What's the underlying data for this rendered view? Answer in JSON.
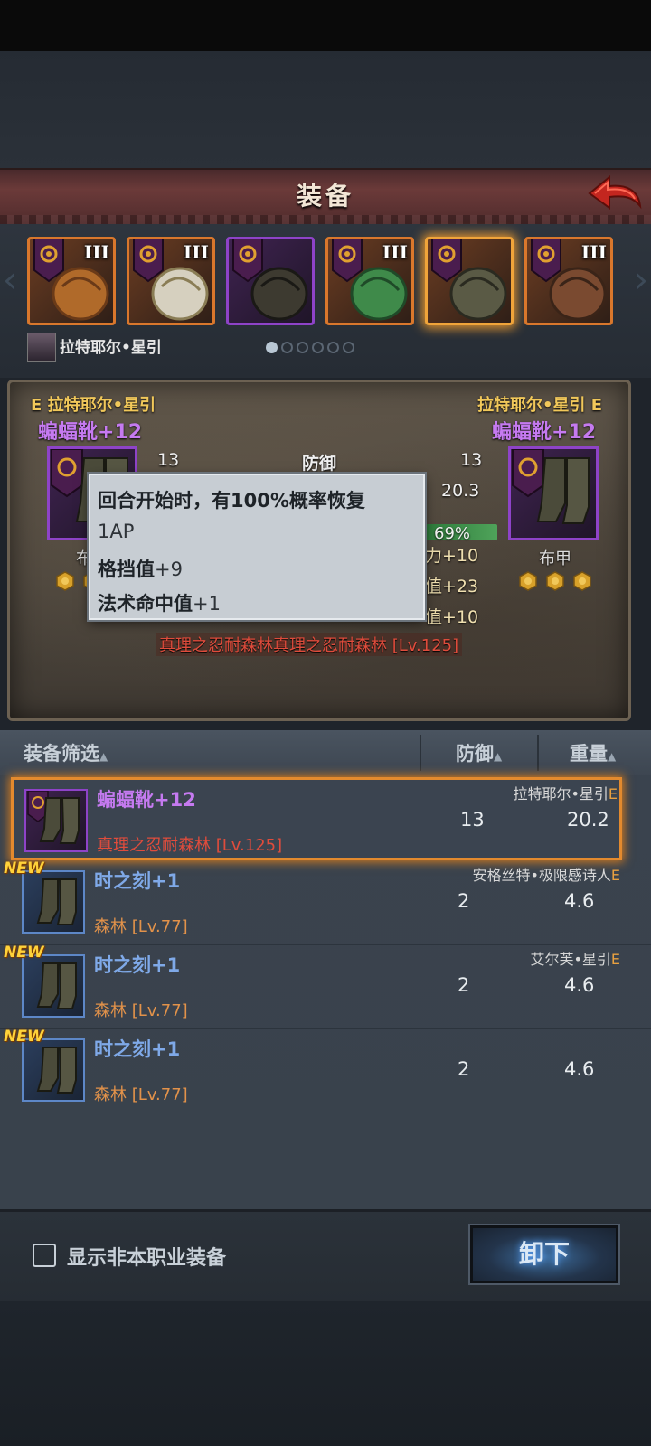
{
  "header": {
    "title": "装备"
  },
  "slots": [
    {
      "tier": "III",
      "rarity": "orange",
      "kind": "staff"
    },
    {
      "tier": "III",
      "rarity": "orange",
      "kind": "shoulder-armor"
    },
    {
      "tier": "",
      "rarity": "purple",
      "kind": "hood"
    },
    {
      "tier": "III",
      "rarity": "orange",
      "kind": "green-robe"
    },
    {
      "tier": "",
      "rarity": "orange",
      "kind": "boots",
      "selected": true
    },
    {
      "tier": "III",
      "rarity": "orange",
      "kind": "book"
    }
  ],
  "character": {
    "name": "拉特耶尔•星引"
  },
  "compare": {
    "left": {
      "grade": "E",
      "owner": "拉特耶尔•星引",
      "item": "蝙蝠靴",
      "plus": "+12",
      "type_partial": "布"
    },
    "right": {
      "grade": "E",
      "owner": "拉特耶尔•星引",
      "item": "蝙蝠靴",
      "plus": "+12",
      "type": "布甲"
    },
    "stats": {
      "defense_label": "防御",
      "left_defense": "13",
      "right_defense": "13",
      "right_weight": "20.3",
      "percent": "69%",
      "bonus1": "力+10",
      "bonus2": "值+23",
      "bonus3": "值+10"
    },
    "set_line": "真理之忍耐森林真理之忍耐森林",
    "set_level": "[Lv.125]"
  },
  "tooltip": {
    "line1": "回合开始时，有100%概率恢复",
    "line2": "1AP",
    "line3_label": "格挡值",
    "line3_value": "+9",
    "line4_label": "法术命中值",
    "line4_value": "+1"
  },
  "list_header": {
    "filter": "装备筛选",
    "defense": "防御",
    "weight": "重量"
  },
  "list": [
    {
      "name": "蝙蝠靴",
      "plus": "+12",
      "set": "真理之忍耐森林",
      "level": "[Lv.125]",
      "owner": "拉特耶尔•星引",
      "grade": "E",
      "defense": "13",
      "weight": "20.2",
      "is_new": false,
      "rarity": "purple",
      "selected": true
    },
    {
      "name": "时之刻",
      "plus": "+1",
      "set": "森林",
      "level": "[Lv.77]",
      "owner": "安格丝特•极限感诗人",
      "grade": "E",
      "defense": "2",
      "weight": "4.6",
      "is_new": true,
      "rarity": "blue",
      "selected": false
    },
    {
      "name": "时之刻",
      "plus": "+1",
      "set": "森林",
      "level": "[Lv.77]",
      "owner": "艾尔芙•星引",
      "grade": "E",
      "defense": "2",
      "weight": "4.6",
      "is_new": true,
      "rarity": "blue",
      "selected": false
    },
    {
      "name": "时之刻",
      "plus": "+1",
      "set": "森林",
      "level": "[Lv.77]",
      "owner": "",
      "grade": "",
      "defense": "2",
      "weight": "4.6",
      "is_new": true,
      "rarity": "blue",
      "selected": false
    }
  ],
  "new_badge": "NEW",
  "bottom": {
    "checkbox_label": "显示非本职业装备",
    "checked": false,
    "unequip_label": "卸下"
  }
}
